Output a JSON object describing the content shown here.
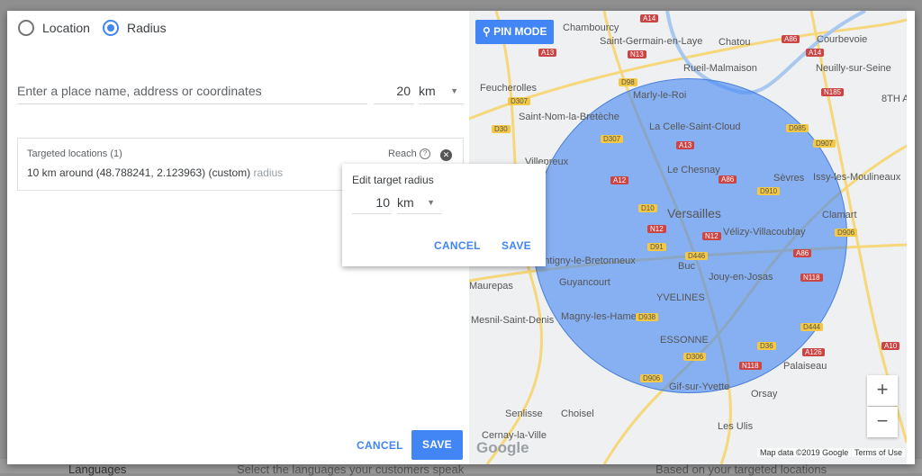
{
  "background": {
    "languages_label": "Languages",
    "languages_hint": "Select the languages your customers speak",
    "languages_value": "Based on your targeted locations"
  },
  "mode": {
    "options": [
      {
        "label": "Location",
        "selected": false
      },
      {
        "label": "Radius",
        "selected": true
      }
    ]
  },
  "search": {
    "placeholder": "Enter a place name, address or coordinates",
    "radius_value": "20",
    "unit": "km"
  },
  "targeted": {
    "title": "Targeted locations (1)",
    "reach_label": "Reach",
    "item_main": "10 km around (48.788241, 2.123963) (custom)",
    "item_type": "radius"
  },
  "edit_popup": {
    "title": "Edit target radius",
    "radius_value": "10",
    "unit": "km",
    "cancel": "CANCEL",
    "save": "SAVE"
  },
  "footer": {
    "cancel": "CANCEL",
    "save": "SAVE"
  },
  "map": {
    "pin_mode": "PIN MODE",
    "google_logo": "Google",
    "attribution": "Map data ©2019 Google",
    "terms": "Terms of Use",
    "zoom_in": "+",
    "zoom_out": "−",
    "circle_color": "#4285f4",
    "places": [
      "Chambourcy",
      "Saint-Germain-en-Laye",
      "Chatou",
      "Courbevoie",
      "Rueil-Malmaison",
      "Neuilly-sur-Seine",
      "Feucherolles",
      "Marly-le-Roi",
      "8TH A",
      "Saint-Nom-la-Bretèche",
      "La Celle-Saint-Cloud",
      "Villepreux",
      "Le Chesnay",
      "Sèvres",
      "Issy-les-Moulineaux",
      "Versailles",
      "Clamart",
      "Vélizy-Villacoublay",
      "Montigny-le-Bretonneux",
      "Buc",
      "Jouy-en-Josas",
      "Guyancourt",
      "Maurepas",
      "YVELINES",
      "Magny-les-Hameaux",
      "Mesnil-Saint-Denis",
      "ESSONNE",
      "Palaiseau",
      "Gif-sur-Yvette",
      "Orsay",
      "Senlisse",
      "Choisel",
      "Cernay-la-Ville",
      "Les Ulis"
    ],
    "roads": [
      "A14",
      "A13",
      "N13",
      "D98",
      "A86",
      "A14",
      "N185",
      "D307",
      "D30",
      "D307",
      "A13",
      "D985",
      "D907",
      "A12",
      "A86",
      "D910",
      "D10",
      "N12",
      "N12",
      "D91",
      "D446",
      "A86",
      "N118",
      "D906",
      "D938",
      "D36",
      "A126",
      "D306",
      "N118",
      "D444",
      "A10",
      "D906"
    ]
  }
}
